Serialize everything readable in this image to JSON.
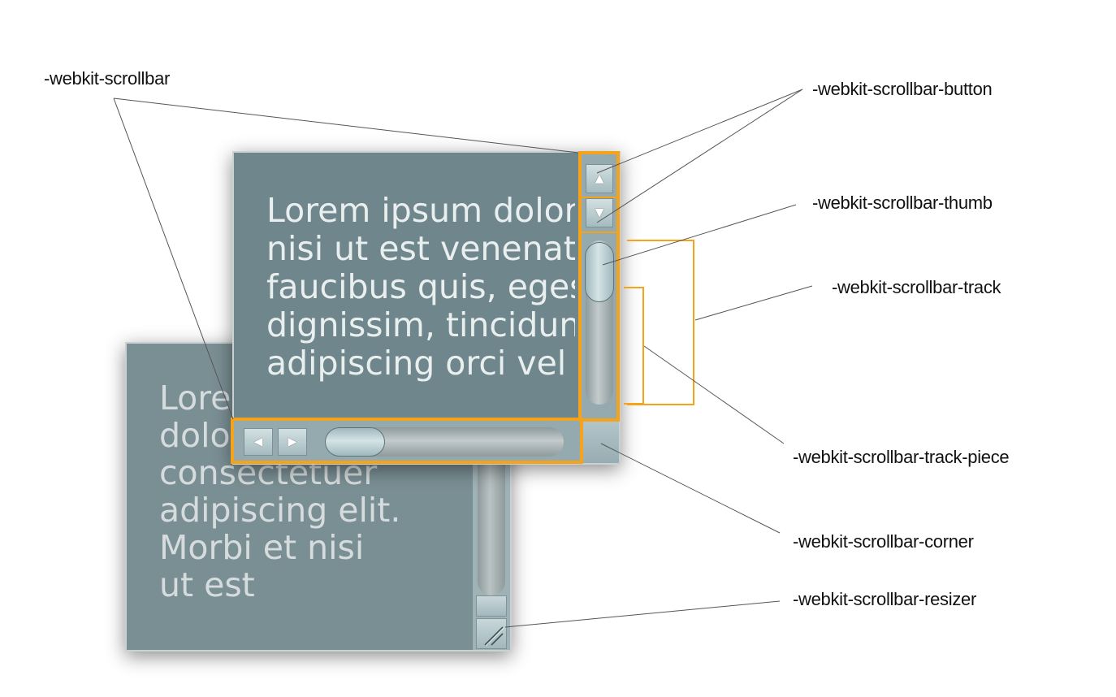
{
  "labels": {
    "scrollbar": "-webkit-scrollbar",
    "button": "-webkit-scrollbar-button",
    "thumb": "-webkit-scrollbar-thumb",
    "track": "-webkit-scrollbar-track",
    "track_piece": "-webkit-scrollbar-track-piece",
    "corner": "-webkit-scrollbar-corner",
    "resizer": "-webkit-scrollbar-resizer"
  },
  "front_box": {
    "lines": [
      "Lorem ipsum dolor sit amet,",
      "nisi ut est venenatis et",
      "faucibus quis, egestas",
      "dignissim, tincidunt",
      "adipiscing orci vel"
    ]
  },
  "back_box": {
    "lines": [
      "Lorem ipsum",
      "dolor sit amet,",
      "consectetuer",
      "adipiscing elit.",
      "Morbi et nisi",
      "ut est"
    ]
  },
  "glyphs": {
    "up": "▲",
    "down": "▼",
    "left": "◀",
    "right": "▶"
  },
  "colors": {
    "highlight": "#f5a31a",
    "leader_line": "#555555",
    "box_front": "#6f878c",
    "box_back": "#7a8f94"
  }
}
